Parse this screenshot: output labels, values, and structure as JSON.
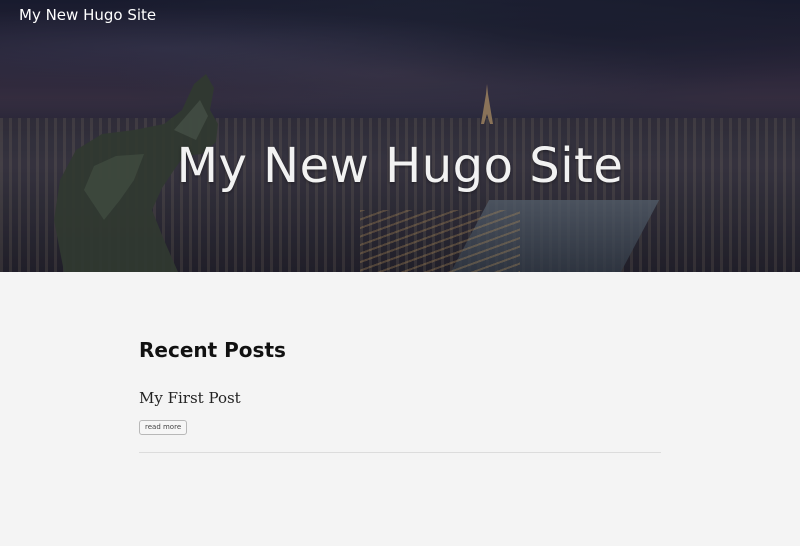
{
  "header": {
    "site_title": "My New Hugo Site"
  },
  "hero": {
    "title": "My New Hugo Site"
  },
  "main": {
    "section_heading": "Recent Posts",
    "posts": [
      {
        "title": "My First Post",
        "read_more_label": "read more"
      }
    ]
  }
}
